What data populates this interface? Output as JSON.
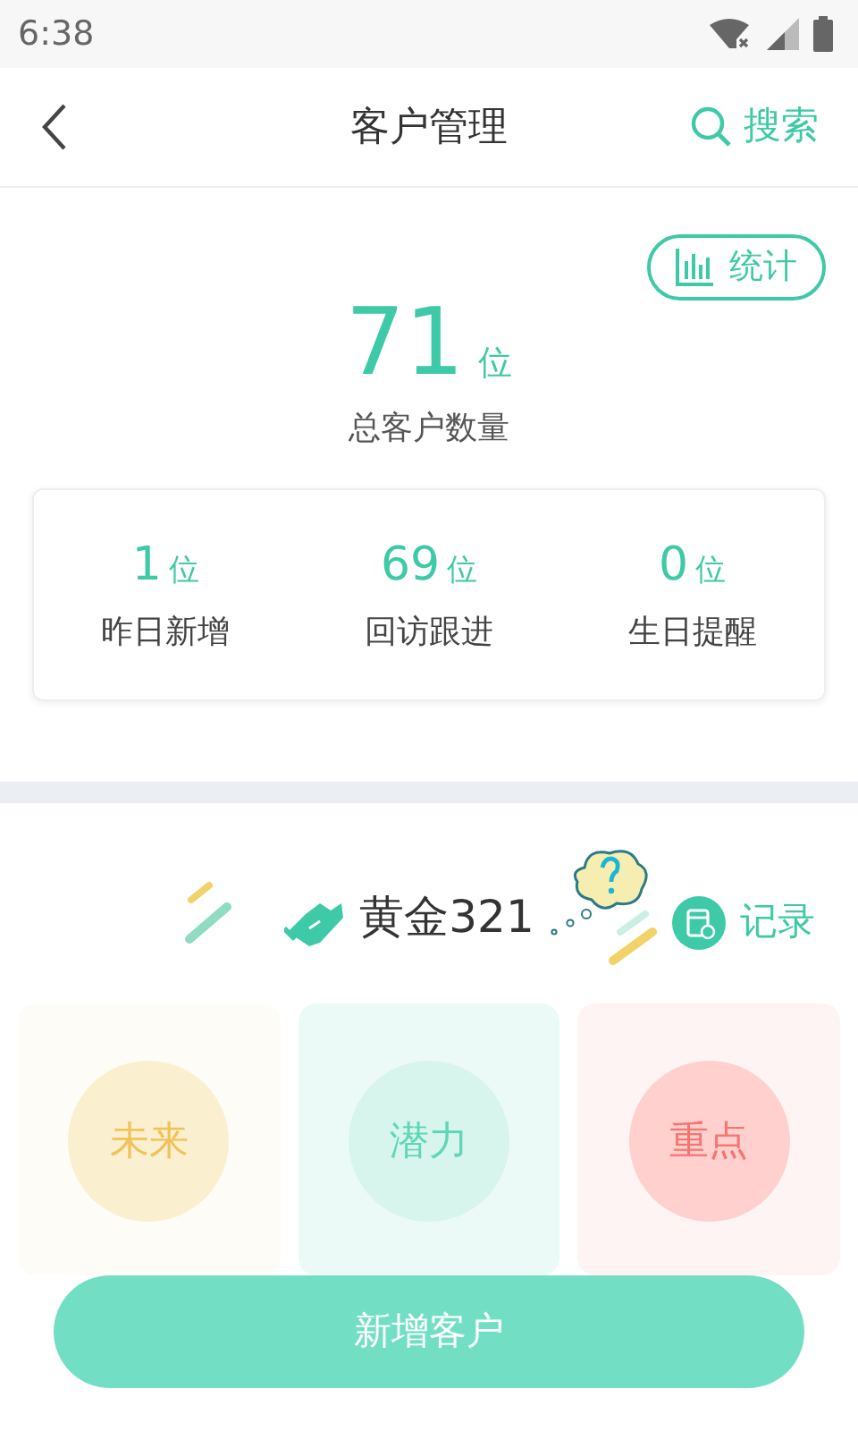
{
  "status_bar": {
    "time": "6:38"
  },
  "header": {
    "title": "客户管理",
    "search": "搜索"
  },
  "summary": {
    "stats_button": "统计",
    "total": "71",
    "total_unit": "位",
    "total_label": "总客户数量",
    "metrics": [
      {
        "value": "1",
        "unit": "位",
        "label": "昨日新增"
      },
      {
        "value": "69",
        "unit": "位",
        "label": "回访跟进"
      },
      {
        "value": "0",
        "unit": "位",
        "label": "生日提醒"
      }
    ]
  },
  "group": {
    "name": "黄金321",
    "record": "记录",
    "categories": [
      {
        "kind": "future",
        "badge": "未来"
      },
      {
        "kind": "potential",
        "badge": "潜力"
      },
      {
        "kind": "key",
        "badge": "重点"
      }
    ]
  },
  "add_button": "新增客户"
}
